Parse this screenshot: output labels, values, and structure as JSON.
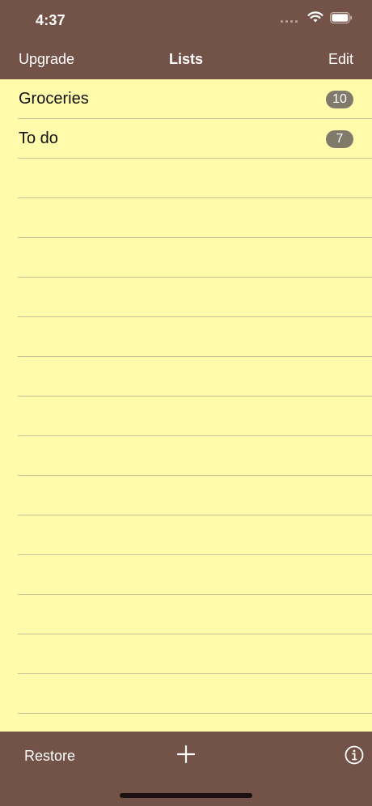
{
  "status_bar": {
    "time": "4:37"
  },
  "nav": {
    "left": "Upgrade",
    "title": "Lists",
    "right": "Edit"
  },
  "lists": [
    {
      "name": "Groceries",
      "count": "10"
    },
    {
      "name": "To do",
      "count": "7"
    }
  ],
  "toolbar": {
    "restore": "Restore"
  },
  "colors": {
    "bar": "#735247",
    "paper": "#FFFBAA",
    "badge": "#7f7a6a"
  },
  "icons": {
    "wifi": "wifi-icon",
    "battery": "battery-icon",
    "add": "plus-icon",
    "info": "info-icon"
  }
}
